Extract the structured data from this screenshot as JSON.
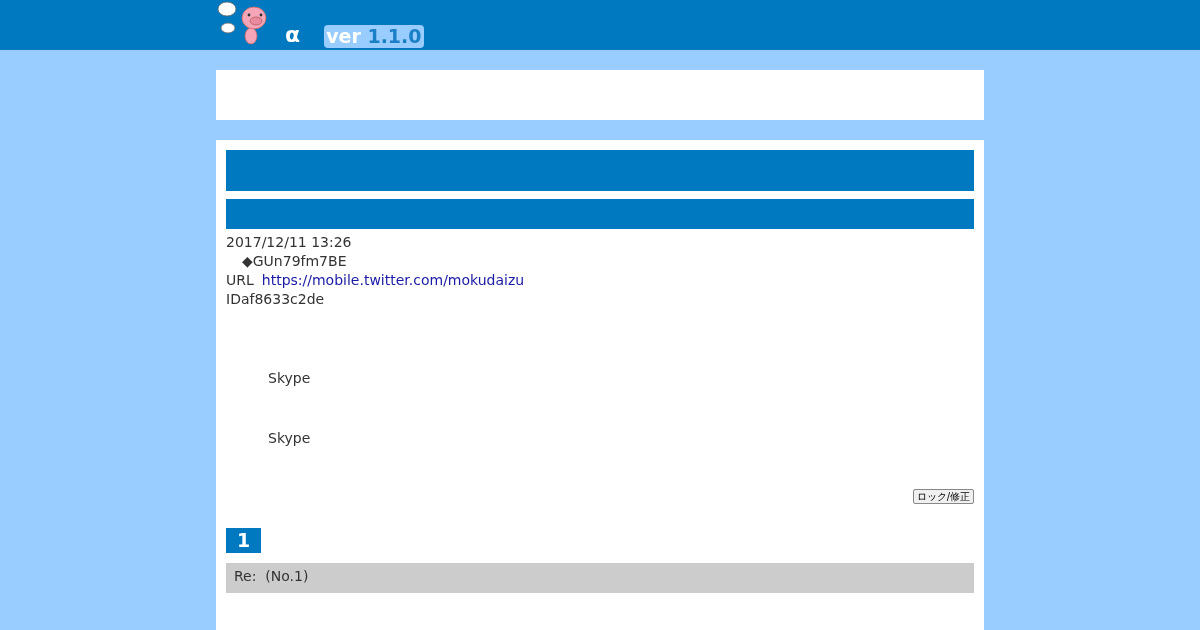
{
  "header": {
    "title": "α",
    "version_label": "ver",
    "version_number": "1.1.0"
  },
  "post": {
    "date": "2017/12/11 13:26",
    "trip": "◆GUn79fm7BE",
    "url_label": "URL",
    "url": "https://mobile.twitter.com/mokudaizu",
    "id": "IDaf8633c2de",
    "body_lines": [
      "Skype",
      "Skype"
    ],
    "lock_button": "ロック/修正"
  },
  "reply": {
    "number": "1",
    "title": "Re:  (No.1)"
  }
}
